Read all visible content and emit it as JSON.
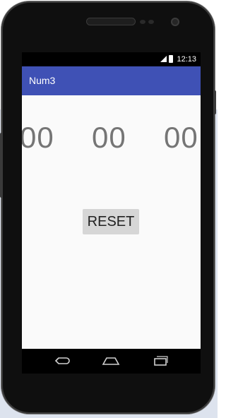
{
  "app": {
    "title": "Num3"
  },
  "status_bar": {
    "time": "12:13"
  },
  "counter": {
    "left": "00",
    "middle": "00",
    "right": "00"
  },
  "controls": {
    "reset_label": "RESET"
  },
  "nav": {
    "back_icon": "back-icon",
    "home_icon": "home-icon",
    "recents_icon": "recents-icon"
  },
  "colors": {
    "app_bar": "#3f51b5",
    "digits": "#757575",
    "reset_bg": "#d6d6d6"
  }
}
